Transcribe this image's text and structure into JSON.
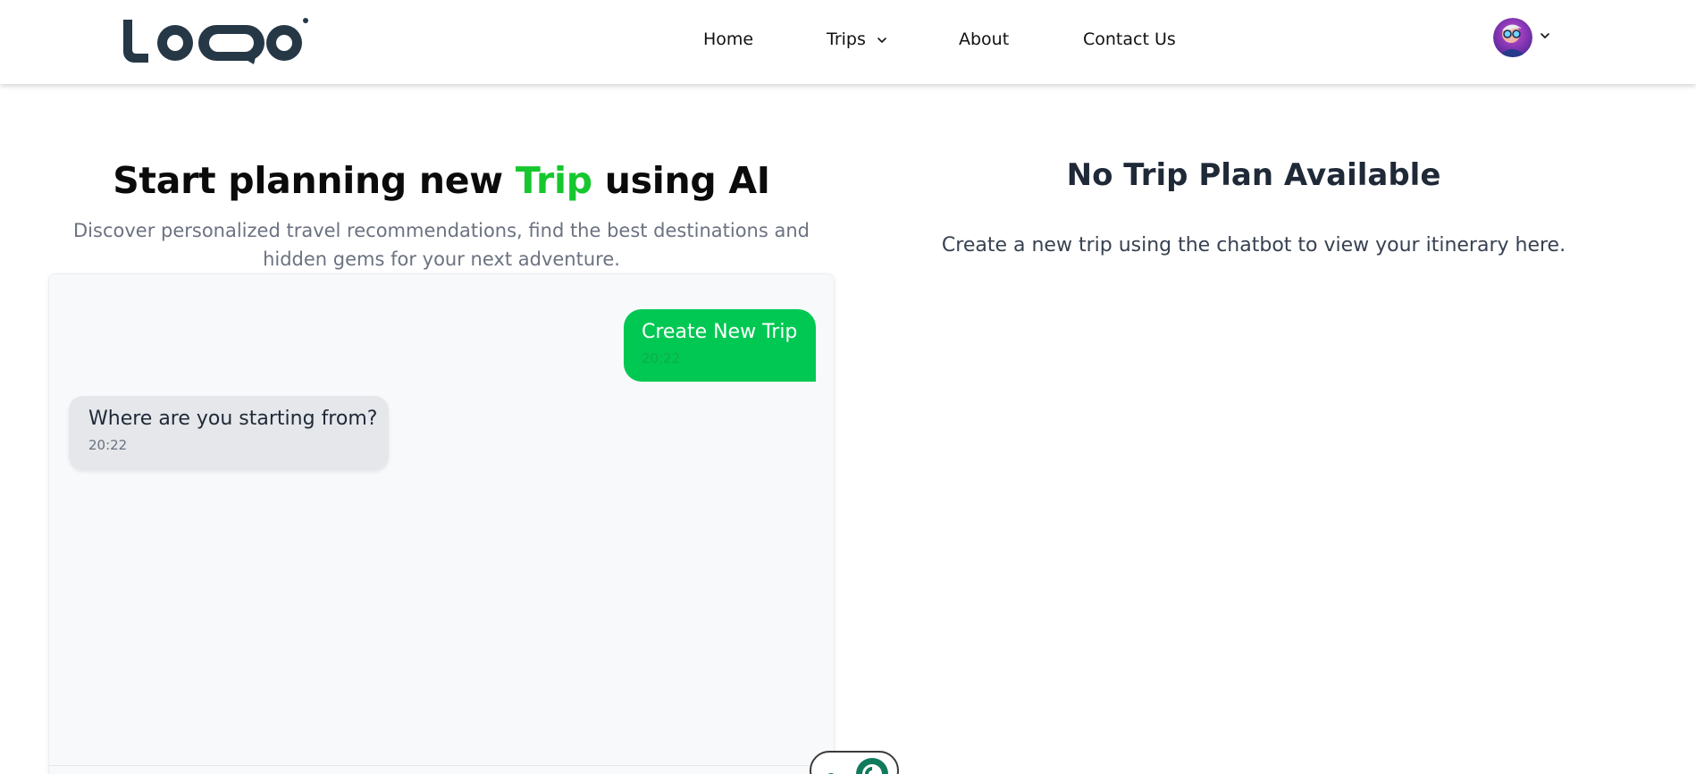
{
  "header": {
    "logo_text": "LOQO",
    "nav": [
      {
        "label": "Home"
      },
      {
        "label": "Trips"
      },
      {
        "label": "About"
      },
      {
        "label": "Contact Us"
      }
    ]
  },
  "hero": {
    "title_prefix": "Start planning new ",
    "title_accent": "Trip",
    "title_suffix": " using AI",
    "subtitle": "Discover personalized travel recommendations, find the best destinations and hidden gems for your next adventure."
  },
  "chat": {
    "messages": [
      {
        "role": "user",
        "text": "Create New Trip",
        "time": "20:22"
      },
      {
        "role": "bot",
        "text": "Where are you starting from?",
        "time": "20:22"
      }
    ]
  },
  "plan": {
    "title": "No Trip Plan Available",
    "text": "Create a new trip using the chatbot to view your itinerary here."
  },
  "colors": {
    "accent": "#16c72e",
    "user_bubble": "#00c853",
    "bot_bubble": "#e5e7eb",
    "logo": "#263746"
  },
  "icons": {
    "trips_dropdown": "chevron-down-icon",
    "avatar_dropdown": "chevron-down-icon"
  }
}
